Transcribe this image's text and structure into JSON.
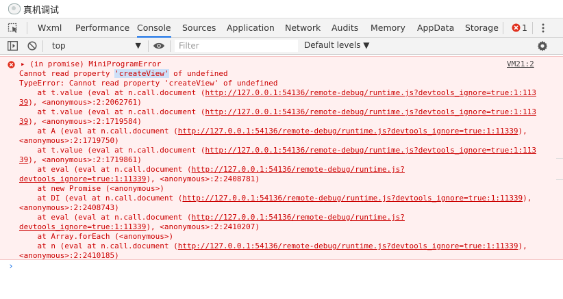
{
  "window": {
    "title": "真机调试"
  },
  "tabs": [
    {
      "label": "Wxml"
    },
    {
      "label": "Performance"
    },
    {
      "label": "Console"
    },
    {
      "label": "Sources"
    },
    {
      "label": "Application"
    },
    {
      "label": "Network"
    },
    {
      "label": "Audits"
    },
    {
      "label": "Memory"
    },
    {
      "label": "AppData"
    },
    {
      "label": "Storage"
    }
  ],
  "active_tab": "Console",
  "error_count": "1",
  "toolbar": {
    "context": "top",
    "filter_placeholder": "Filter",
    "levels": "Default levels ▼"
  },
  "error": {
    "header": "▸ (in promise) MiniProgramError",
    "source": "VM21:2",
    "message_prefix": "Cannot read property ",
    "message_selected": "'createView'",
    "message_suffix": " of undefined",
    "type_line": "TypeError: Cannot read property 'createView' of undefined",
    "frames": [
      {
        "pre": "    at t.value (eval at n.call.document (",
        "link": "http://127.0.0.1:54136/remote-debug/runtime.js?devtools_ignore=true:1:113",
        "post": ""
      },
      {
        "pre": "",
        "link": "39",
        "post": "), <anonymous>:2:2062761)"
      },
      {
        "pre": "    at t.value (eval at n.call.document (",
        "link": "http://127.0.0.1:54136/remote-debug/runtime.js?devtools_ignore=true:1:113",
        "post": ""
      },
      {
        "pre": "",
        "link": "39",
        "post": "), <anonymous>:2:1719584)"
      },
      {
        "pre": "    at A (eval at n.call.document (",
        "link": "http://127.0.0.1:54136/remote-debug/runtime.js?devtools_ignore=true:1:11339",
        "post": "),"
      },
      {
        "pre": "<anonymous>:2:1719750)",
        "link": "",
        "post": ""
      },
      {
        "pre": "    at t.value (eval at n.call.document (",
        "link": "http://127.0.0.1:54136/remote-debug/runtime.js?devtools_ignore=true:1:113",
        "post": ""
      },
      {
        "pre": "",
        "link": "39",
        "post": "), <anonymous>:2:1719861)"
      },
      {
        "pre": "    at eval (eval at n.call.document (",
        "link": "http://127.0.0.1:54136/remote-debug/runtime.js?",
        "post": ""
      },
      {
        "pre": "",
        "link": "devtools_ignore=true:1:11339",
        "post": "), <anonymous>:2:2408781)"
      },
      {
        "pre": "    at new Promise (<anonymous>)",
        "link": "",
        "post": ""
      },
      {
        "pre": "    at DI (eval at n.call.document (",
        "link": "http://127.0.0.1:54136/remote-debug/runtime.js?devtools_ignore=true:1:11339",
        "post": "),"
      },
      {
        "pre": "<anonymous>:2:2408743)",
        "link": "",
        "post": ""
      },
      {
        "pre": "    at eval (eval at n.call.document (",
        "link": "http://127.0.0.1:54136/remote-debug/runtime.js?",
        "post": ""
      },
      {
        "pre": "",
        "link": "devtools_ignore=true:1:11339",
        "post": "), <anonymous>:2:2410207)"
      },
      {
        "pre": "    at Array.forEach (<anonymous>)",
        "link": "",
        "post": ""
      },
      {
        "pre": "    at n (eval at n.call.document (",
        "link": "http://127.0.0.1:54136/remote-debug/runtime.js?devtools_ignore=true:1:11339",
        "post": "),"
      },
      {
        "pre": "<anonymous>:2:2410185)",
        "link": "",
        "post": ""
      }
    ]
  },
  "prompt_symbol": "›",
  "colors": {
    "accent": "#1a73e8",
    "error_text": "#c00000",
    "error_bg": "#fff0f0",
    "toolbar_bg": "#f3f3f3"
  }
}
